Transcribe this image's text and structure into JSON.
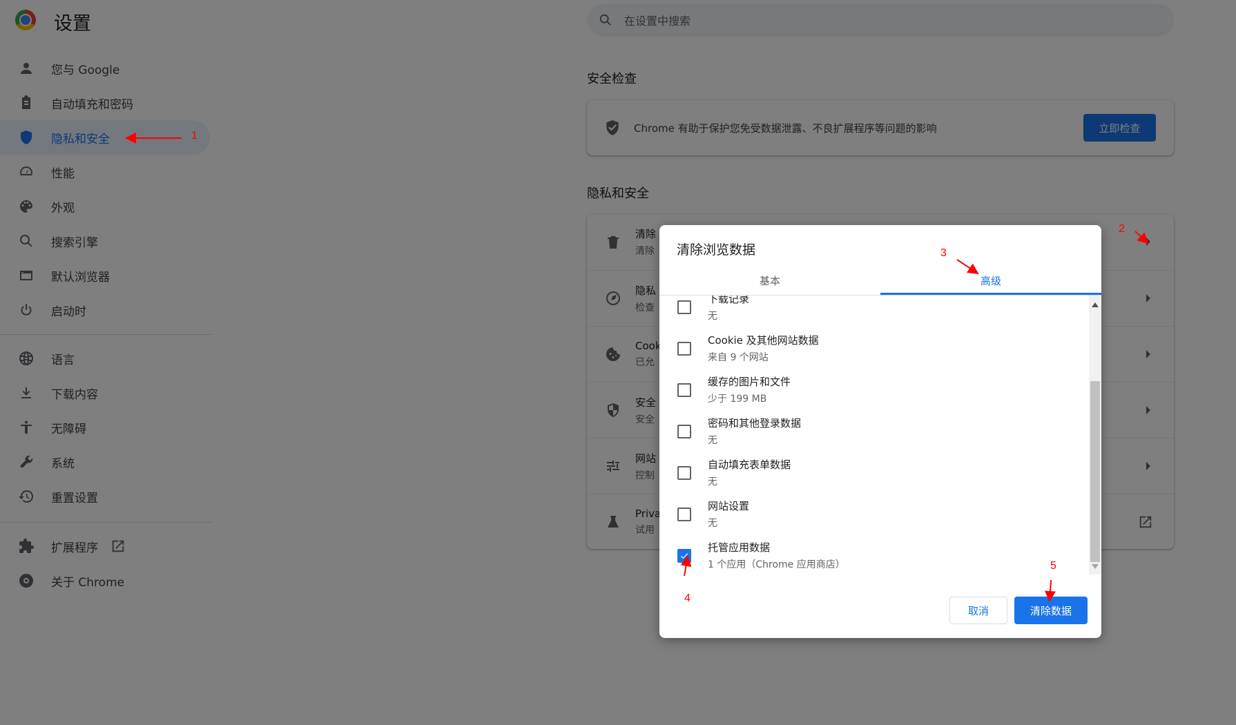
{
  "app": {
    "title": "设置"
  },
  "sidebar": {
    "items": [
      {
        "label": "您与 Google",
        "icon": "person-icon"
      },
      {
        "label": "自动填充和密码",
        "icon": "clipboard-icon"
      },
      {
        "label": "隐私和安全",
        "icon": "shield-icon",
        "active": true
      },
      {
        "label": "性能",
        "icon": "speedometer-icon"
      },
      {
        "label": "外观",
        "icon": "palette-icon"
      },
      {
        "label": "搜索引擎",
        "icon": "search-icon"
      },
      {
        "label": "默认浏览器",
        "icon": "browser-icon"
      },
      {
        "label": "启动时",
        "icon": "power-icon"
      },
      {
        "label": "语言",
        "icon": "globe-icon"
      },
      {
        "label": "下载内容",
        "icon": "download-icon"
      },
      {
        "label": "无障碍",
        "icon": "accessibility-icon"
      },
      {
        "label": "系统",
        "icon": "wrench-icon"
      },
      {
        "label": "重置设置",
        "icon": "history-icon"
      },
      {
        "label": "扩展程序",
        "icon": "puzzle-icon"
      },
      {
        "label": "关于 Chrome",
        "icon": "chrome-icon"
      }
    ]
  },
  "search": {
    "placeholder": "在设置中搜索"
  },
  "safety_check": {
    "section_title": "安全检查",
    "text": "Chrome 有助于保护您免受数据泄露、不良扩展程序等问题的影响",
    "button": "立即检查"
  },
  "privacy": {
    "section_title": "隐私和安全",
    "rows": [
      {
        "title": "清除",
        "subtitle": "清除"
      },
      {
        "title": "隐私",
        "subtitle": "检查"
      },
      {
        "title": "Cook",
        "subtitle": "已允"
      },
      {
        "title": "安全",
        "subtitle": "安全"
      },
      {
        "title": "网站",
        "subtitle": "控制"
      },
      {
        "title": "Priva",
        "subtitle": "试用"
      }
    ]
  },
  "dialog": {
    "title": "清除浏览数据",
    "tabs": {
      "basic": "基本",
      "advanced": "高级"
    },
    "items": [
      {
        "title": "下载记录",
        "subtitle": "无",
        "checked": false
      },
      {
        "title": "Cookie 及其他网站数据",
        "subtitle": "来自 9 个网站",
        "checked": false
      },
      {
        "title": "缓存的图片和文件",
        "subtitle": "少于 199 MB",
        "checked": false
      },
      {
        "title": "密码和其他登录数据",
        "subtitle": "无",
        "checked": false
      },
      {
        "title": "自动填充表单数据",
        "subtitle": "无",
        "checked": false
      },
      {
        "title": "网站设置",
        "subtitle": "无",
        "checked": false
      },
      {
        "title": "托管应用数据",
        "subtitle": "1 个应用（Chrome 应用商店）",
        "checked": true
      }
    ],
    "cancel": "取消",
    "confirm": "清除数据"
  },
  "annotations": [
    "1",
    "2",
    "3",
    "4",
    "5"
  ],
  "colors": {
    "accent": "#1a73e8",
    "annotation": "#ff0000"
  }
}
